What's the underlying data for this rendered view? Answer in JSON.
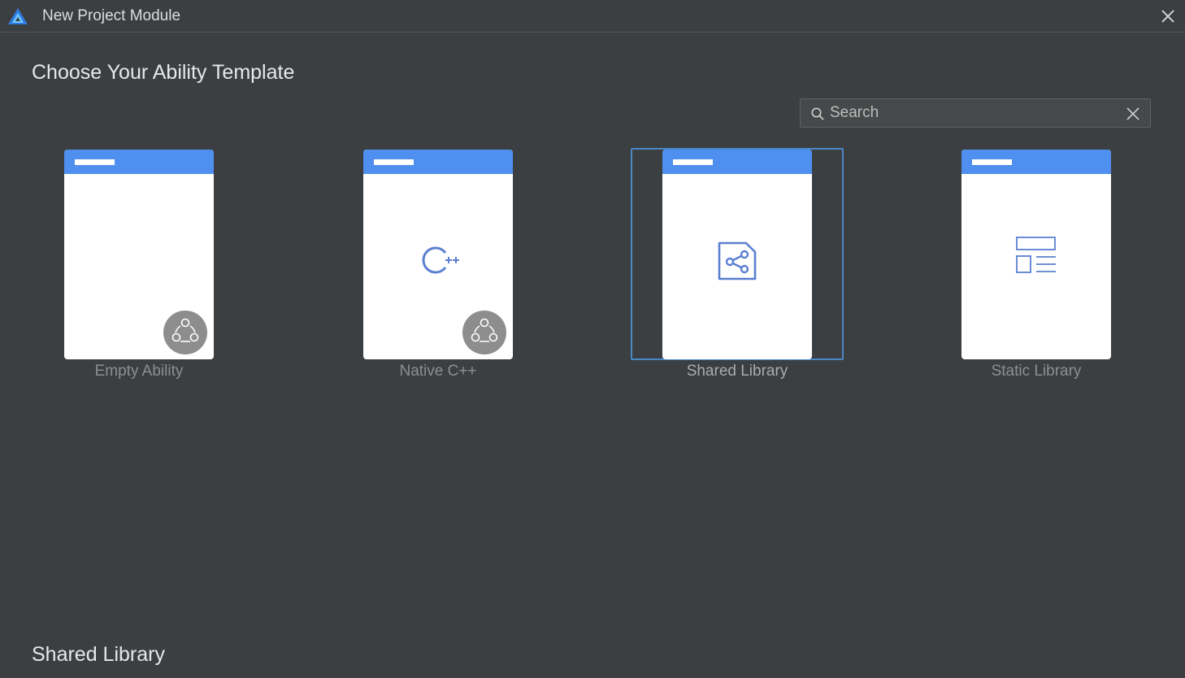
{
  "window": {
    "title": "New Project Module",
    "logo_icon": "deveco-logo-icon",
    "close_icon": "close-icon"
  },
  "heading": "Choose Your Ability Template",
  "search": {
    "placeholder": "Search",
    "value": "",
    "icon": "search-icon",
    "clear_icon": "clear-icon"
  },
  "templates": [
    {
      "label": "Empty Ability",
      "icon": "none",
      "badge": "atomic-service-icon",
      "selected": false
    },
    {
      "label": "Native C++",
      "icon": "cpp-icon",
      "badge": "atomic-service-icon",
      "selected": false
    },
    {
      "label": "Shared Library",
      "icon": "share-icon",
      "badge": "",
      "selected": true
    },
    {
      "label": "Static Library",
      "icon": "layout-list-icon",
      "badge": "",
      "selected": false
    }
  ],
  "footer": {
    "selected_title": "Shared Library"
  },
  "colors": {
    "background": "#3c3f41",
    "card_header": "#4f8ff0",
    "selection_border": "#4a88c7",
    "icon_blue": "#5b7fd1"
  }
}
